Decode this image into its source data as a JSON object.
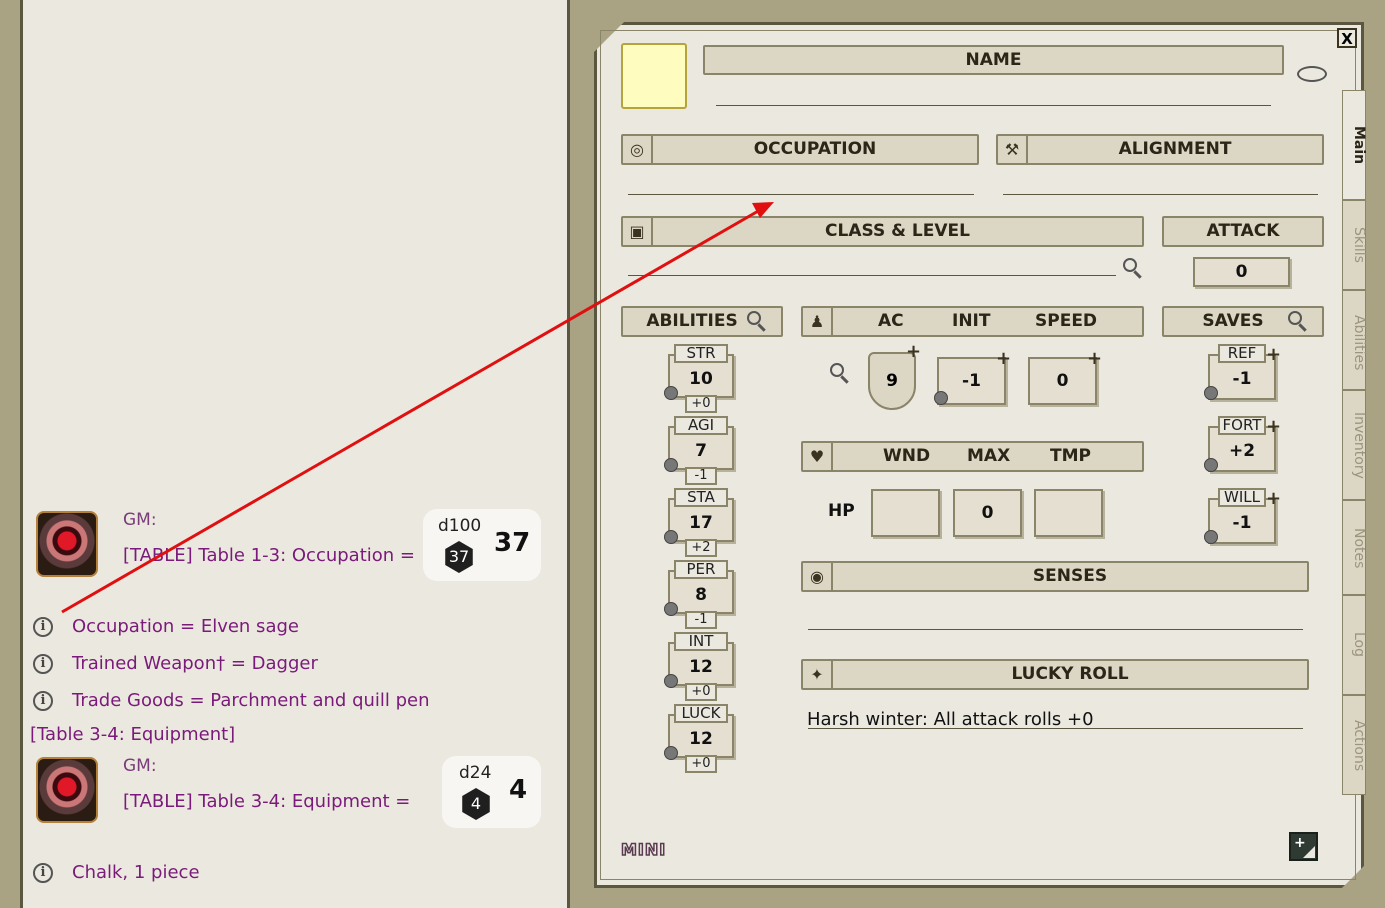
{
  "chat": {
    "entries": [
      {
        "speaker": "GM:",
        "text": "[TABLE] Table 1-3: Occupation =",
        "die_label": "d100",
        "die_value": "37",
        "total": "37"
      },
      {
        "speaker": "GM:",
        "text": "[TABLE] Table 3-4: Equipment =",
        "die_label": "d24",
        "die_value": "4",
        "total": "4"
      }
    ],
    "lines": [
      "Occupation = Elven sage",
      "Trained Weapon† = Dagger",
      "Trade Goods = Parchment and quill pen",
      "[Table 3-4: Equipment]",
      "Chalk, 1 piece"
    ]
  },
  "sheet": {
    "close": "X",
    "name_label": "NAME",
    "occupation_label": "OCCUPATION",
    "alignment_label": "ALIGNMENT",
    "class_level_label": "CLASS & LEVEL",
    "attack_label": "ATTACK",
    "attack_value": "0",
    "abilities_label": "ABILITIES",
    "abilities": [
      {
        "name": "STR",
        "score": "10",
        "mod": "+0"
      },
      {
        "name": "AGI",
        "score": "7",
        "mod": "-1"
      },
      {
        "name": "STA",
        "score": "17",
        "mod": "+2"
      },
      {
        "name": "PER",
        "score": "8",
        "mod": "-1"
      },
      {
        "name": "INT",
        "score": "12",
        "mod": "+0"
      },
      {
        "name": "LUCK",
        "score": "12",
        "mod": "+0"
      }
    ],
    "combat": {
      "ac_label": "AC",
      "init_label": "INIT",
      "speed_label": "SPEED",
      "ac": "9",
      "init": "-1",
      "speed": "0"
    },
    "health": {
      "wnd_label": "WND",
      "max_label": "MAX",
      "tmp_label": "TMP",
      "hp_label": "HP",
      "wnd": "",
      "max": "0",
      "tmp": ""
    },
    "saves_label": "SAVES",
    "saves": [
      {
        "name": "REF",
        "value": "-1"
      },
      {
        "name": "FORT",
        "value": "+2"
      },
      {
        "name": "WILL",
        "value": "-1"
      }
    ],
    "senses_label": "SENSES",
    "lucky_roll_label": "LUCKY ROLL",
    "lucky_roll_text": "Harsh winter: All attack rolls +0",
    "mini_label": "MINI",
    "tabs": [
      "Main",
      "Skills",
      "Abilities",
      "Inventory",
      "Notes",
      "Log",
      "Actions"
    ]
  }
}
